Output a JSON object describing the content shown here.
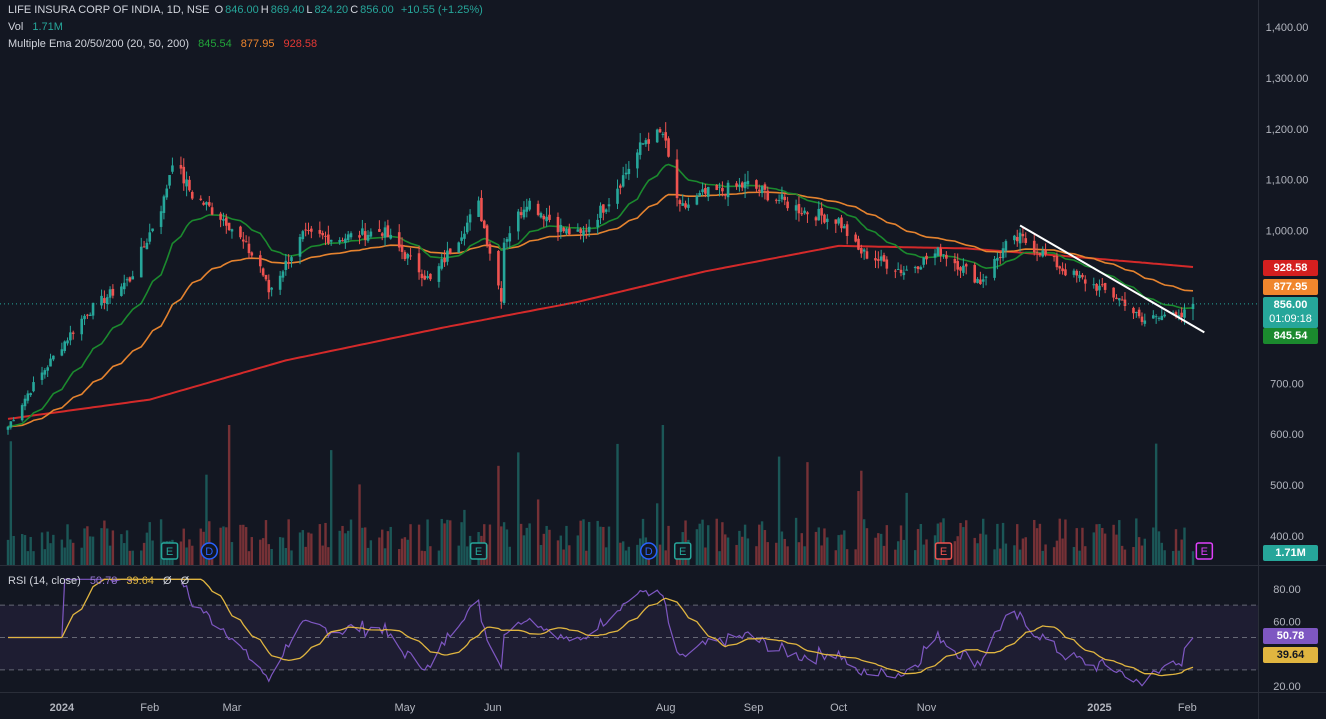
{
  "header": {
    "symbol": "LIFE INSURA CORP OF INDIA, 1D, NSE",
    "ohlc": [
      {
        "key": "O",
        "value": "846.00"
      },
      {
        "key": "H",
        "value": "869.40"
      },
      {
        "key": "L",
        "value": "824.20"
      },
      {
        "key": "C",
        "value": "856.00"
      }
    ],
    "change": "+10.55 (+1.25%)",
    "vol_label": "Vol",
    "vol_value": "1.71M",
    "ema_label": "Multiple Ema 20/50/200 (20, 50, 200)",
    "ema20": "845.54",
    "ema50": "877.95",
    "ema200": "928.58",
    "rsi_label": "RSI (14, close)",
    "rsi_value": "50.78",
    "rsi_ma": "39.64",
    "rsi_extra1": "Ø",
    "rsi_extra2": "Ø"
  },
  "price_tags": {
    "ema200": "928.58",
    "ema50": "877.95",
    "last": "856.00",
    "countdown": "01:09:18",
    "ema20": "845.54",
    "volume": "1.71M",
    "rsi": "50.78",
    "rsi_ma": "39.64"
  },
  "colors": {
    "background": "#131722",
    "up": "#26a69a",
    "down": "#ef5350",
    "ema20": "#1b8a2e",
    "ema50": "#e5832f",
    "ema200": "#d42a2a",
    "rsi": "#7e57c2",
    "rsi_ma": "#e0b540",
    "trendline": "#ffffff"
  },
  "chart_data": {
    "type": "candlestick",
    "price_axis_ticks": [
      "1,400.00",
      "1,300.00",
      "1,200.00",
      "1,100.00",
      "1,000.00",
      "700.00",
      "600.00",
      "500.00",
      "400.00"
    ],
    "rsi_axis_ticks": [
      "80.00",
      "60.00",
      "20.00"
    ],
    "time_labels": [
      "2024",
      "Feb",
      "Mar",
      "May",
      "Jun",
      "Aug",
      "Sep",
      "Oct",
      "Nov",
      "2025",
      "Feb"
    ],
    "price_range": [
      380,
      1440
    ],
    "rsi_range": [
      14,
      88
    ],
    "rsi_levels": [
      70,
      50,
      30
    ],
    "close_anchors": [
      {
        "date": "2023-12-13",
        "close": 615
      },
      {
        "date": "2023-12-20",
        "close": 680
      },
      {
        "date": "2024-01-01",
        "close": 775
      },
      {
        "date": "2024-01-10",
        "close": 840
      },
      {
        "date": "2024-01-25",
        "close": 905
      },
      {
        "date": "2024-02-06",
        "close": 1060
      },
      {
        "date": "2024-02-09",
        "close": 1140
      },
      {
        "date": "2024-02-16",
        "close": 1070
      },
      {
        "date": "2024-02-28",
        "close": 1020
      },
      {
        "date": "2024-03-11",
        "close": 930
      },
      {
        "date": "2024-03-14",
        "close": 880
      },
      {
        "date": "2024-03-26",
        "close": 990
      },
      {
        "date": "2024-04-08",
        "close": 985
      },
      {
        "date": "2024-04-23",
        "close": 1000
      },
      {
        "date": "2024-05-10",
        "close": 900
      },
      {
        "date": "2024-05-27",
        "close": 1050
      },
      {
        "date": "2024-06-04",
        "close": 870
      },
      {
        "date": "2024-06-05",
        "close": 980
      },
      {
        "date": "2024-06-13",
        "close": 1060
      },
      {
        "date": "2024-06-26",
        "close": 1000
      },
      {
        "date": "2024-07-02",
        "close": 990
      },
      {
        "date": "2024-07-12",
        "close": 1060
      },
      {
        "date": "2024-07-25",
        "close": 1180
      },
      {
        "date": "2024-07-31",
        "close": 1190
      },
      {
        "date": "2024-08-06",
        "close": 1040
      },
      {
        "date": "2024-08-14",
        "close": 1070
      },
      {
        "date": "2024-08-30",
        "close": 1090
      },
      {
        "date": "2024-09-18",
        "close": 1040
      },
      {
        "date": "2024-10-01",
        "close": 1020
      },
      {
        "date": "2024-10-08",
        "close": 960
      },
      {
        "date": "2024-10-24",
        "close": 920
      },
      {
        "date": "2024-11-06",
        "close": 960
      },
      {
        "date": "2024-11-20",
        "close": 900
      },
      {
        "date": "2024-11-29",
        "close": 970
      },
      {
        "date": "2024-12-04",
        "close": 985
      },
      {
        "date": "2024-12-11",
        "close": 960
      },
      {
        "date": "2024-12-20",
        "close": 920
      },
      {
        "date": "2024-12-31",
        "close": 890
      },
      {
        "date": "2025-01-10",
        "close": 860
      },
      {
        "date": "2025-01-16",
        "close": 820
      },
      {
        "date": "2025-01-23",
        "close": 840
      },
      {
        "date": "2025-01-29",
        "close": 825
      },
      {
        "date": "2025-02-03",
        "close": 856
      }
    ],
    "ema200_anchors": [
      {
        "date": "2023-12-13",
        "value": 630
      },
      {
        "date": "2024-02-01",
        "value": 668
      },
      {
        "date": "2024-03-20",
        "value": 745
      },
      {
        "date": "2024-05-15",
        "value": 810
      },
      {
        "date": "2024-07-01",
        "value": 860
      },
      {
        "date": "2024-08-15",
        "value": 920
      },
      {
        "date": "2024-10-01",
        "value": 970
      },
      {
        "date": "2024-11-15",
        "value": 965
      },
      {
        "date": "2024-12-20",
        "value": 950
      },
      {
        "date": "2025-02-03",
        "value": 928.58
      }
    ],
    "trendline": [
      {
        "date": "2024-12-04",
        "price": 1010
      },
      {
        "date": "2025-02-07",
        "price": 800
      }
    ],
    "event_markers": [
      {
        "date": "2024-02-08",
        "label": "E",
        "color": "#26a69a"
      },
      {
        "date": "2024-02-22",
        "label": "D",
        "color": "#2962ff"
      },
      {
        "date": "2024-05-27",
        "label": "E",
        "color": "#26a69a"
      },
      {
        "date": "2024-07-26",
        "label": "D",
        "color": "#2962ff"
      },
      {
        "date": "2024-08-07",
        "label": "E",
        "color": "#26a69a"
      },
      {
        "date": "2024-11-07",
        "label": "E",
        "color": "#ef5350"
      },
      {
        "date": "2025-02-07",
        "label": "E",
        "color": "#e040fb"
      }
    ]
  }
}
